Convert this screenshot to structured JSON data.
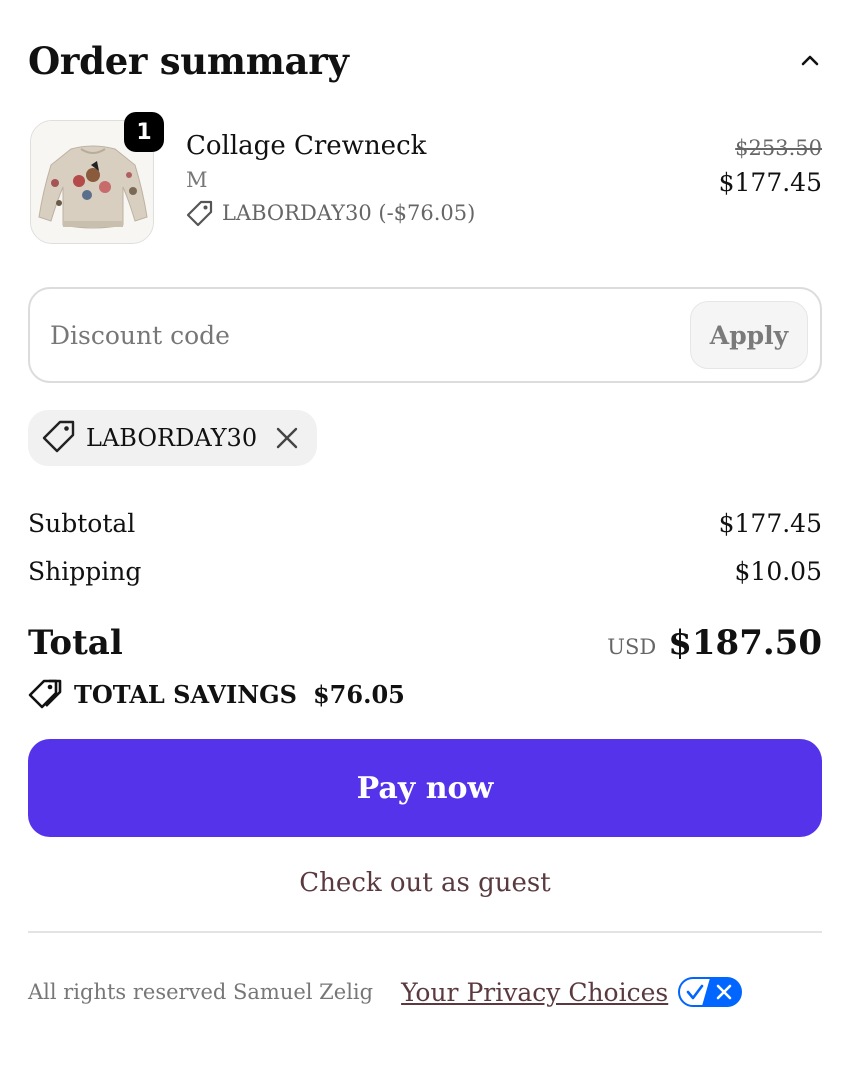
{
  "header": {
    "title": "Order summary",
    "collapse_icon": "chevron-up-icon"
  },
  "item": {
    "quantity": "1",
    "name": "Collage Crewneck",
    "variant": "M",
    "discount": "LABORDAY30 (-$76.05)",
    "original_price": "$253.50",
    "price": "$177.45"
  },
  "discount_field": {
    "placeholder": "Discount code",
    "value": "",
    "apply_label": "Apply"
  },
  "applied_code": {
    "label": "LABORDAY30"
  },
  "summary": {
    "subtotal_label": "Subtotal",
    "subtotal_value": "$177.45",
    "shipping_label": "Shipping",
    "shipping_value": "$10.05",
    "total_label": "Total",
    "currency": "USD",
    "total_value": "$187.50",
    "savings_label": "TOTAL SAVINGS",
    "savings_value": "$76.05"
  },
  "actions": {
    "pay_label": "Pay now",
    "guest_label": "Check out as guest"
  },
  "footer": {
    "rights": "All rights reserved Samuel Zelig",
    "privacy_label": "Your Privacy Choices"
  },
  "colors": {
    "accent": "#5433eb",
    "link": "#5a3a3f",
    "privacy_toggle": "#0066ff"
  }
}
